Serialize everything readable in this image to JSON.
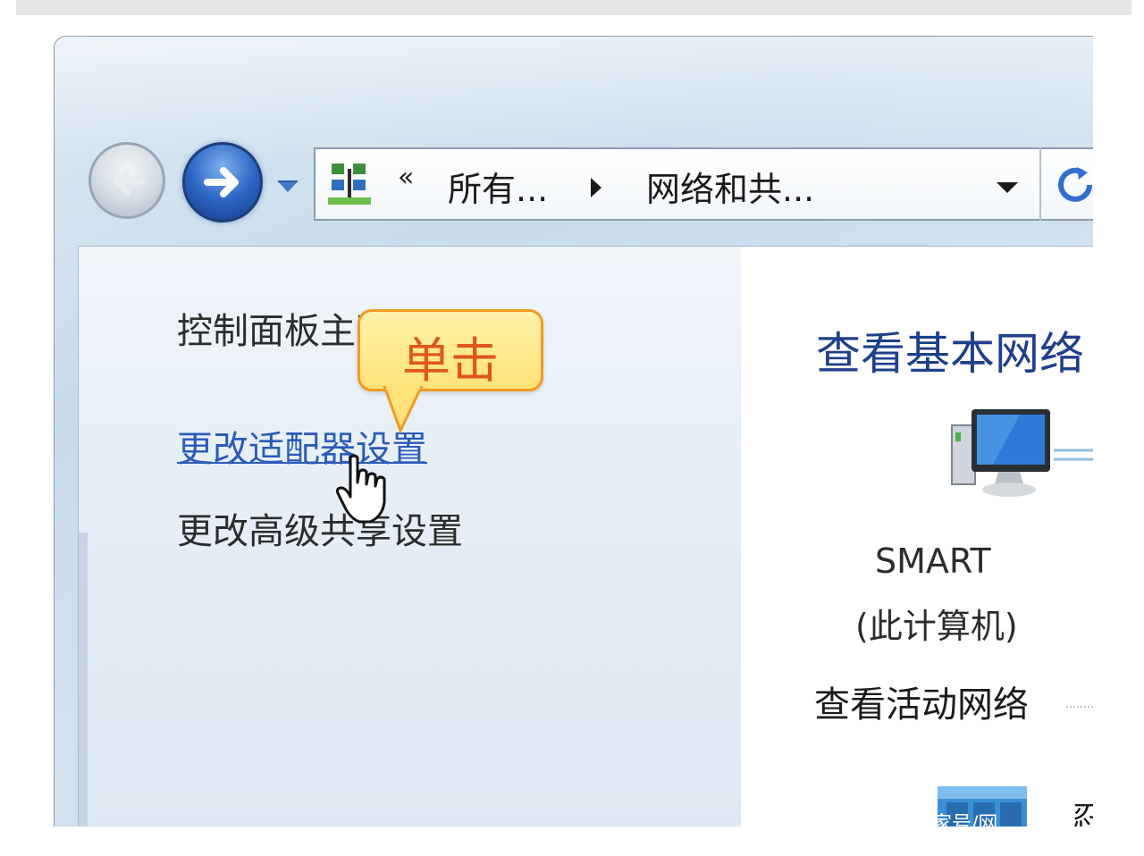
{
  "navigation": {
    "back_icon": "back-arrow-icon",
    "forward_icon": "forward-arrow-icon",
    "history_icon": "chevron-down-icon"
  },
  "address_bar": {
    "location_icon": "network-center-icon",
    "overflow_chevron": "«",
    "breadcrumbs": [
      "所有...",
      "网络和共..."
    ],
    "separator_icon": "triangle-right-icon",
    "dropdown_icon": "chevron-down-icon",
    "refresh_icon": "refresh-icon"
  },
  "left_pane": {
    "tasks": [
      {
        "label": "控制面板主页"
      },
      {
        "label": "更改适配器设置"
      },
      {
        "label": "更改高级共享设置"
      }
    ]
  },
  "callout": {
    "text": "单击",
    "bg_color": "#ffe27a",
    "border_color": "#f29a22",
    "text_color": "#e0561b"
  },
  "right_pane": {
    "title": "查看基本网络",
    "computer_name": "SMART",
    "computer_sub": "(此计算机)",
    "active_networks_heading": "查看活动网络",
    "network_label": "家号/网",
    "edge_glyph": "忍"
  },
  "colors": {
    "link": "#2c5bb8",
    "title": "#1e3f8c",
    "forward_button": "#2d66c4"
  }
}
